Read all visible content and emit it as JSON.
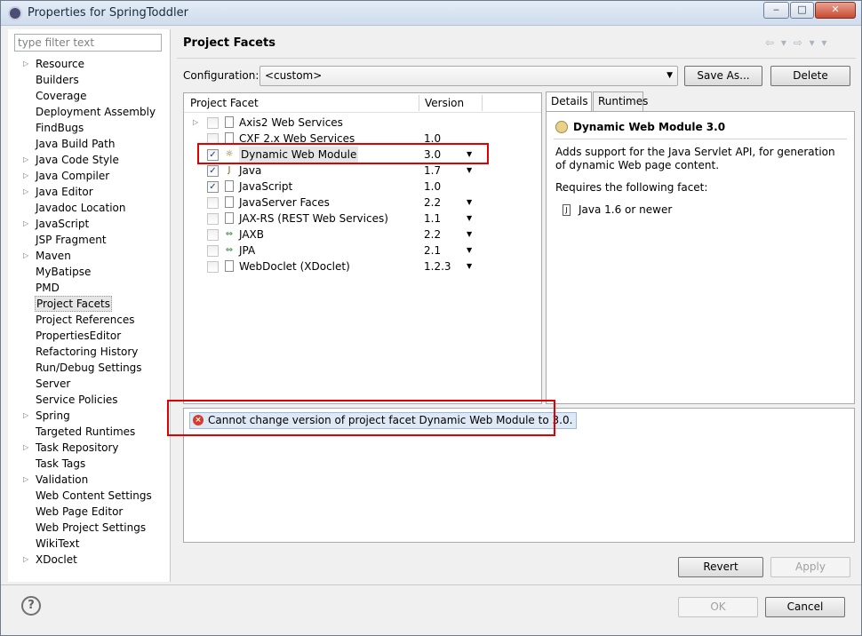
{
  "window": {
    "title": "Properties for SpringToddler",
    "controls": [
      "‒",
      "□",
      "✕"
    ]
  },
  "sidebar": {
    "filter_placeholder": "type filter text",
    "items": [
      {
        "label": "Resource",
        "expandable": true
      },
      {
        "label": "Builders",
        "expandable": false
      },
      {
        "label": "Coverage",
        "expandable": false
      },
      {
        "label": "Deployment Assembly",
        "expandable": false
      },
      {
        "label": "FindBugs",
        "expandable": false
      },
      {
        "label": "Java Build Path",
        "expandable": false
      },
      {
        "label": "Java Code Style",
        "expandable": true
      },
      {
        "label": "Java Compiler",
        "expandable": true
      },
      {
        "label": "Java Editor",
        "expandable": true
      },
      {
        "label": "Javadoc Location",
        "expandable": false
      },
      {
        "label": "JavaScript",
        "expandable": true
      },
      {
        "label": "JSP Fragment",
        "expandable": false
      },
      {
        "label": "Maven",
        "expandable": true
      },
      {
        "label": "MyBatipse",
        "expandable": false
      },
      {
        "label": "PMD",
        "expandable": false
      },
      {
        "label": "Project Facets",
        "expandable": false,
        "selected": true
      },
      {
        "label": "Project References",
        "expandable": false
      },
      {
        "label": "PropertiesEditor",
        "expandable": false
      },
      {
        "label": "Refactoring History",
        "expandable": false
      },
      {
        "label": "Run/Debug Settings",
        "expandable": false
      },
      {
        "label": "Server",
        "expandable": false
      },
      {
        "label": "Service Policies",
        "expandable": false
      },
      {
        "label": "Spring",
        "expandable": true
      },
      {
        "label": "Targeted Runtimes",
        "expandable": false
      },
      {
        "label": "Task Repository",
        "expandable": true
      },
      {
        "label": "Task Tags",
        "expandable": false
      },
      {
        "label": "Validation",
        "expandable": true
      },
      {
        "label": "Web Content Settings",
        "expandable": false
      },
      {
        "label": "Web Page Editor",
        "expandable": false
      },
      {
        "label": "Web Project Settings",
        "expandable": false
      },
      {
        "label": "WikiText",
        "expandable": false
      },
      {
        "label": "XDoclet",
        "expandable": true
      }
    ]
  },
  "page": {
    "title": "Project Facets",
    "nav_icons": "⇦ ▾ ⇨ ▾ ▾"
  },
  "configuration": {
    "label": "Configuration:",
    "value": "<custom>",
    "save_as": "Save As...",
    "delete": "Delete"
  },
  "facets": {
    "col_facet": "Project Facet",
    "col_version": "Version",
    "rows": [
      {
        "name": "Axis2 Web Services",
        "version": "",
        "checked": false,
        "expandable": true,
        "dropdown": false
      },
      {
        "name": "CXF 2.x Web Services",
        "version": "1.0",
        "checked": false,
        "expandable": false,
        "dropdown": false
      },
      {
        "name": "Dynamic Web Module",
        "version": "3.0",
        "checked": true,
        "expandable": false,
        "dropdown": true
      },
      {
        "name": "Java",
        "version": "1.7",
        "checked": true,
        "expandable": false,
        "dropdown": true
      },
      {
        "name": "JavaScript",
        "version": "1.0",
        "checked": true,
        "expandable": false,
        "dropdown": false
      },
      {
        "name": "JavaServer Faces",
        "version": "2.2",
        "checked": false,
        "expandable": false,
        "dropdown": true
      },
      {
        "name": "JAX-RS (REST Web Services)",
        "version": "1.1",
        "checked": false,
        "expandable": false,
        "dropdown": true
      },
      {
        "name": "JAXB",
        "version": "2.2",
        "checked": false,
        "expandable": false,
        "dropdown": true
      },
      {
        "name": "JPA",
        "version": "2.1",
        "checked": false,
        "expandable": false,
        "dropdown": true
      },
      {
        "name": "WebDoclet (XDoclet)",
        "version": "1.2.3",
        "checked": false,
        "expandable": false,
        "dropdown": true
      }
    ]
  },
  "details": {
    "tab_details": "Details",
    "tab_runtimes": "Runtimes",
    "title": "Dynamic Web Module 3.0",
    "description": "Adds support for the Java Servlet API, for generation of dynamic Web page content.",
    "requires": "Requires the following facet:",
    "required_facet": "Java 1.6 or newer"
  },
  "message": {
    "error": "Cannot change version of project facet Dynamic Web Module to 3.0."
  },
  "buttons": {
    "revert": "Revert",
    "apply": "Apply",
    "ok": "OK",
    "cancel": "Cancel"
  },
  "colors": {
    "highlight": "#e00000",
    "error": "#d83b2a"
  }
}
